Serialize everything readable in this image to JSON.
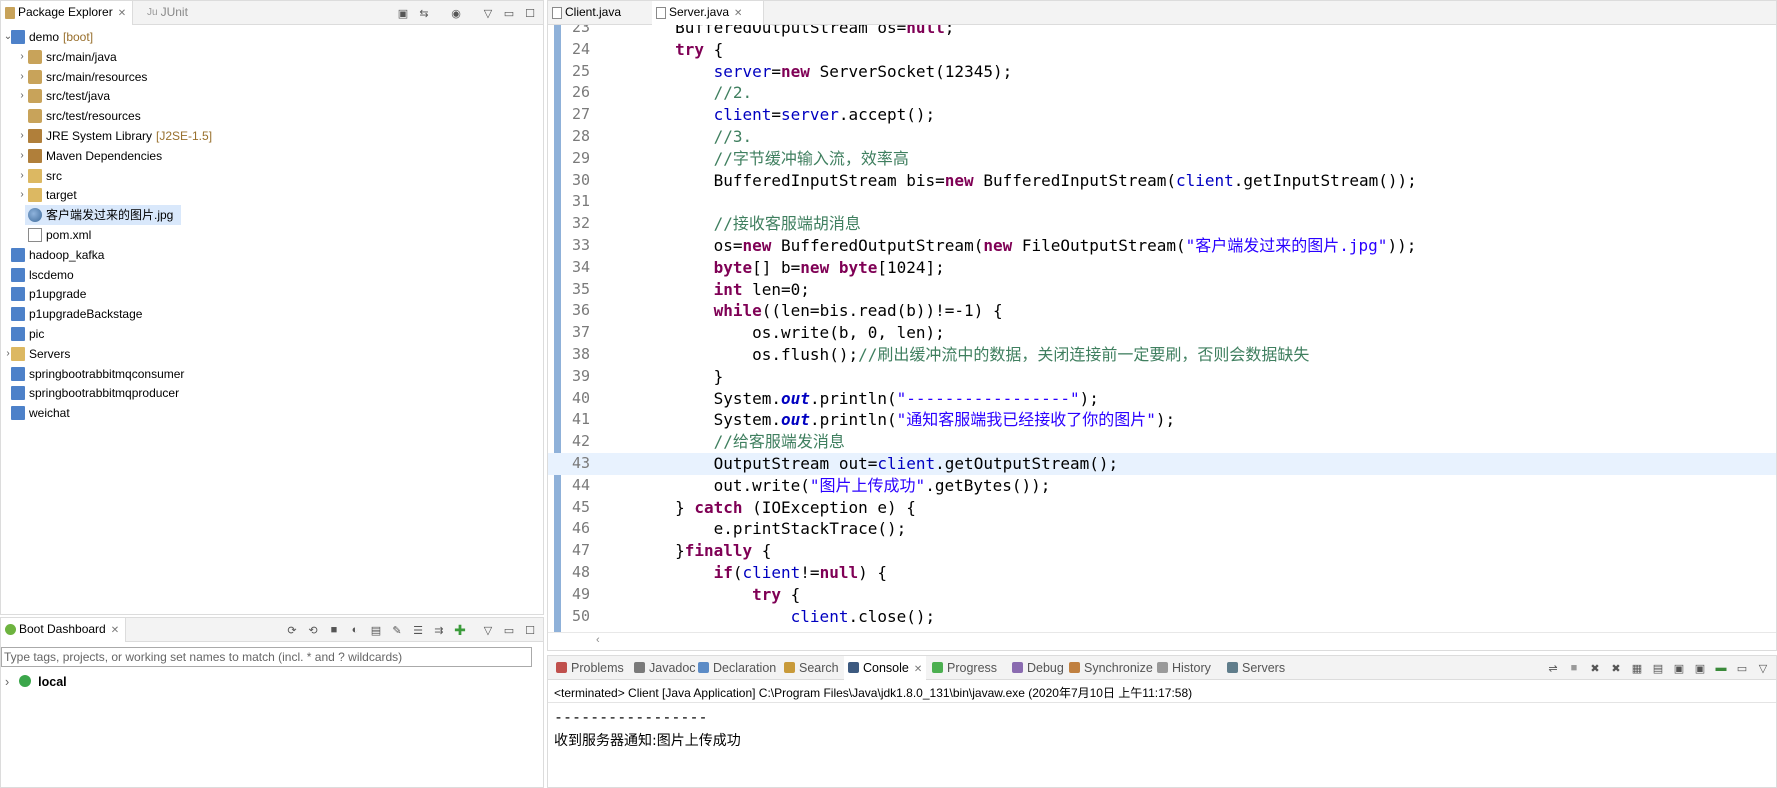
{
  "package_explorer": {
    "tab_label": "Package Explorer",
    "junit_tab_label": "JUnit",
    "items": [
      {
        "label": "demo",
        "deco": "[boot]",
        "depth": 0,
        "expanded": true,
        "icon": "project-icon"
      },
      {
        "label": "src/main/java",
        "depth": 1,
        "expander": true,
        "icon": "source-folder-icon"
      },
      {
        "label": "src/main/resources",
        "depth": 1,
        "expander": true,
        "icon": "source-folder-icon"
      },
      {
        "label": "src/test/java",
        "depth": 1,
        "expander": true,
        "icon": "source-folder-icon"
      },
      {
        "label": "src/test/resources",
        "depth": 1,
        "expander": false,
        "icon": "source-folder-icon"
      },
      {
        "label": "JRE System Library",
        "deco": "[J2SE-1.5]",
        "depth": 1,
        "expander": true,
        "icon": "library-icon"
      },
      {
        "label": "Maven Dependencies",
        "depth": 1,
        "expander": true,
        "icon": "library-icon"
      },
      {
        "label": "src",
        "depth": 1,
        "expander": true,
        "icon": "folder-icon"
      },
      {
        "label": "target",
        "depth": 1,
        "expander": true,
        "icon": "folder-icon"
      },
      {
        "label": "客户端发过来的图片.jpg",
        "depth": 1,
        "expander": false,
        "icon": "image-file-icon",
        "selected": true
      },
      {
        "label": "pom.xml",
        "depth": 1,
        "expander": false,
        "icon": "xml-file-icon"
      },
      {
        "label": "hadoop_kafka",
        "depth": 0,
        "expander": false,
        "icon": "project-icon"
      },
      {
        "label": "lscdemo",
        "depth": 0,
        "expander": false,
        "icon": "project-icon"
      },
      {
        "label": "p1upgrade",
        "depth": 0,
        "expander": false,
        "icon": "project-icon"
      },
      {
        "label": "p1upgradeBackstage",
        "depth": 0,
        "expander": false,
        "icon": "project-icon"
      },
      {
        "label": "pic",
        "depth": 0,
        "expander": false,
        "icon": "project-icon"
      },
      {
        "label": "Servers",
        "depth": 0,
        "expander": true,
        "icon": "folder-icon"
      },
      {
        "label": "springbootrabbitmqconsumer",
        "depth": 0,
        "expander": false,
        "icon": "project-icon"
      },
      {
        "label": "springbootrabbitmqproducer",
        "depth": 0,
        "expander": false,
        "icon": "project-icon"
      },
      {
        "label": "weichat",
        "depth": 0,
        "expander": false,
        "icon": "project-icon"
      }
    ]
  },
  "boot_dashboard": {
    "tab_label": "Boot Dashboard",
    "filter_placeholder": "Type tags, projects, or working set names to match (incl. * and ? wildcards)",
    "items": [
      {
        "label": "local"
      }
    ]
  },
  "editor": {
    "tabs": [
      {
        "label": "Client.java",
        "active": false
      },
      {
        "label": "Server.java",
        "active": true
      }
    ],
    "current_line": 43,
    "lines": [
      {
        "n": "23",
        "html": "        BufferedOutputStream os=<span class=\"k\">null</span>;"
      },
      {
        "n": "24",
        "html": "        <span class=\"k\">try</span> {"
      },
      {
        "n": "25",
        "html": "            <span class=\"f\">server</span>=<span class=\"k\">new</span> ServerSocket(12345);"
      },
      {
        "n": "26",
        "html": "            <span class=\"c\">//2.</span>"
      },
      {
        "n": "27",
        "html": "            <span class=\"f\">client</span>=<span class=\"f\">server</span>.accept();"
      },
      {
        "n": "28",
        "html": "            <span class=\"c\">//3.</span>"
      },
      {
        "n": "29",
        "html": "            <span class=\"c\">//字节缓冲输入流，效率高</span>"
      },
      {
        "n": "30",
        "html": "            BufferedInputStream bis=<span class=\"k\">new</span> BufferedInputStream(<span class=\"f\">client</span>.getInputStream());"
      },
      {
        "n": "31",
        "html": ""
      },
      {
        "n": "32",
        "html": "            <span class=\"c\">//接收客服端胡消息</span>"
      },
      {
        "n": "33",
        "html": "            os=<span class=\"k\">new</span> BufferedOutputStream(<span class=\"k\">new</span> FileOutputStream(<span class=\"s\">\"客户端发过来的图片.jpg\"</span>));"
      },
      {
        "n": "34",
        "html": "            <span class=\"k\">byte</span>[] b=<span class=\"k\">new</span> <span class=\"k\">byte</span>[1024];"
      },
      {
        "n": "35",
        "html": "            <span class=\"k\">int</span> len=0;"
      },
      {
        "n": "36",
        "html": "            <span class=\"k\">while</span>((len=bis.read(b))!=-1) {"
      },
      {
        "n": "37",
        "html": "                os.write(b, 0, len);"
      },
      {
        "n": "38",
        "html": "                os.flush();<span class=\"c\">//刷出缓冲流中的数据，关闭连接前一定要刷，否则会数据缺失</span>"
      },
      {
        "n": "39",
        "html": "            }"
      },
      {
        "n": "40",
        "html": "            System.<span class=\"so\">out</span>.println(<span class=\"s\">\"-----------------\"</span>);"
      },
      {
        "n": "41",
        "html": "            System.<span class=\"so\">out</span>.println(<span class=\"s\">\"通知客服端我已经接收了你的图片\"</span>);"
      },
      {
        "n": "42",
        "html": "            <span class=\"c\">//给客服端发消息</span>"
      },
      {
        "n": "43",
        "html": "            OutputStream out=<span class=\"f\">client</span>.getOutputStream();"
      },
      {
        "n": "44",
        "html": "            out.write(<span class=\"s\">\"图片上传成功\"</span>.getBytes());"
      },
      {
        "n": "45",
        "html": "        } <span class=\"k\">catch</span> (IOException e) {"
      },
      {
        "n": "46",
        "html": "            e.printStackTrace();"
      },
      {
        "n": "47",
        "html": "        }<span class=\"k\">finally</span> {"
      },
      {
        "n": "48",
        "html": "            <span class=\"k\">if</span>(<span class=\"f\">client</span>!=<span class=\"k\">null</span>) {"
      },
      {
        "n": "49",
        "html": "                <span class=\"k\">try</span> {"
      },
      {
        "n": "50",
        "html": "                    <span class=\"f\">client</span>.close();"
      }
    ]
  },
  "bottom_panel": {
    "tabs": [
      {
        "label": "Problems",
        "color": "#c0504d"
      },
      {
        "label": "Javadoc",
        "color": "#7a7a7a"
      },
      {
        "label": "Declaration",
        "color": "#5b8bc6"
      },
      {
        "label": "Search",
        "color": "#c89a3a"
      },
      {
        "label": "Console",
        "color": "#3d5a80",
        "active": true
      },
      {
        "label": "Progress",
        "color": "#4caf50"
      },
      {
        "label": "Debug",
        "color": "#8a6bb0"
      },
      {
        "label": "Synchronize",
        "color": "#c08040"
      },
      {
        "label": "History",
        "color": "#9a9a9a"
      },
      {
        "label": "Servers",
        "color": "#607d8b"
      }
    ],
    "console_header": "<terminated> Client [Java Application] C:\\Program Files\\Java\\jdk1.8.0_131\\bin\\javaw.exe (2020年7月10日 上午11:17:58)",
    "console_lines": [
      "-----------------",
      "收到服务器通知:图片上传成功"
    ]
  }
}
